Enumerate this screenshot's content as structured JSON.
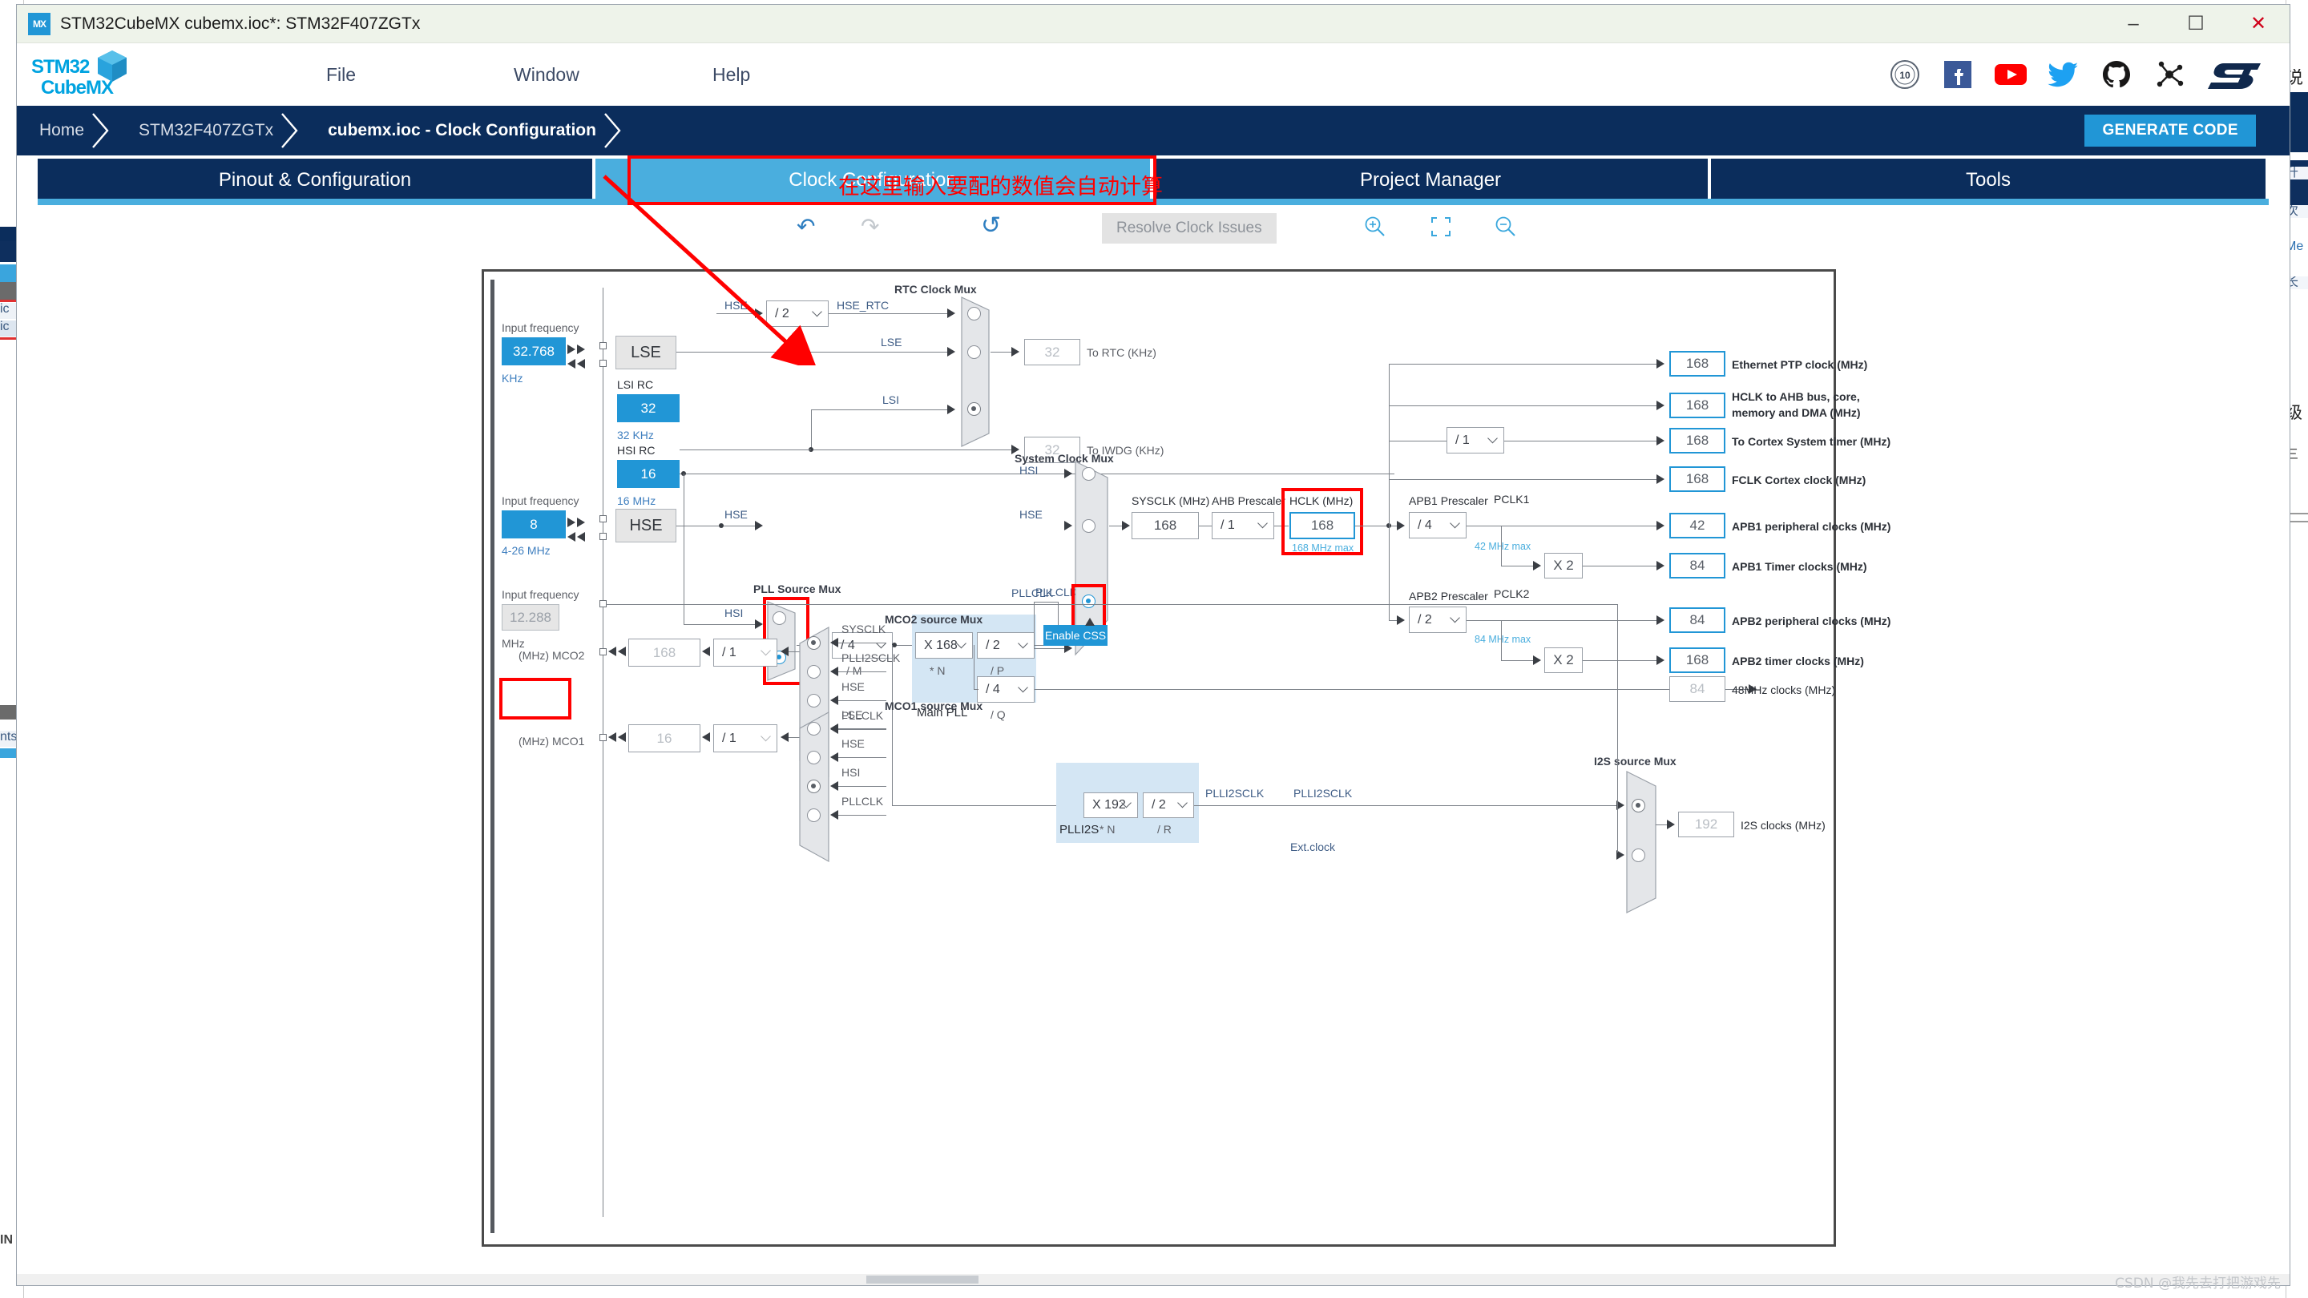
{
  "window": {
    "title": "STM32CubeMX cubemx.ioc*: STM32F407ZGTx",
    "app_icon": "mx-icon",
    "minimize": "─",
    "maximize": "☐",
    "close": "✕"
  },
  "brand": {
    "line1": "STM32",
    "line2": "CubeMX",
    "cube_icon": "cube-icon"
  },
  "menu": [
    {
      "label": "File"
    },
    {
      "label": "Window"
    },
    {
      "label": "Help"
    }
  ],
  "socials": [
    {
      "name": "anniversary-10-icon"
    },
    {
      "name": "facebook-icon"
    },
    {
      "name": "youtube-icon"
    },
    {
      "name": "twitter-icon"
    },
    {
      "name": "github-icon"
    },
    {
      "name": "community-icon"
    },
    {
      "name": "st-logo-icon"
    }
  ],
  "breadcrumb": {
    "items": [
      {
        "label": "Home",
        "active": false
      },
      {
        "label": "STM32F407ZGTx",
        "active": false
      },
      {
        "label": "cubemx.ioc - Clock Configuration",
        "active": true
      }
    ],
    "generate_code": "GENERATE CODE"
  },
  "tabs": [
    {
      "label": "Pinout & Configuration",
      "selected": false
    },
    {
      "label": "Clock Configuration",
      "selected": true
    },
    {
      "label": "Project Manager",
      "selected": false
    },
    {
      "label": "Tools",
      "selected": false
    }
  ],
  "toolbar": {
    "undo": "↶",
    "redo": "↷",
    "reset": "↺",
    "resolve_label": "Resolve Clock Issues",
    "zoom_in": "zoom-in-icon",
    "fit": "fit-to-screen-icon",
    "zoom_out": "zoom-out-icon"
  },
  "annotation": {
    "text": "在这里输入要配的数值会自动计算",
    "color": "#ff0000"
  },
  "watermark": "CSDN @我先去打把游戏先",
  "diagram": {
    "lse": {
      "input_frequency_label": "Input frequency",
      "value": "32.768",
      "unit": "KHz",
      "source_label": "LSE"
    },
    "lsi": {
      "title": "LSI RC",
      "value": "32",
      "unit": "32 KHz"
    },
    "hsi": {
      "title": "HSI RC",
      "value": "16",
      "unit": "16 MHz"
    },
    "hse": {
      "input_frequency_label": "Input frequency",
      "value": "8",
      "range": "4-26 MHz",
      "source_label": "HSE"
    },
    "i2s_in": {
      "input_frequency_label": "Input frequency",
      "value": "12.288",
      "unit": "MHz"
    },
    "rtc_mux": {
      "title": "RTC Clock Mux",
      "hse_label": "HSE",
      "hse_div": "/ 2",
      "hse_rtc_label": "HSE_RTC",
      "lse_label": "LSE",
      "lsi_label": "LSI",
      "selected": "LSI",
      "to_rtc_value": "32",
      "to_rtc_label": "To RTC (KHz)",
      "to_iwdg_value": "32",
      "to_iwdg_label": "To IWDG (KHz)"
    },
    "pll_source_mux": {
      "title": "PLL Source Mux",
      "hsi_label": "HSI",
      "hse_label": "HSE",
      "selected": "HSE"
    },
    "main_pll": {
      "title": "Main PLL",
      "m_value": "/ 4",
      "m_label": "/ M",
      "n_value": "X 168",
      "n_label": "* N",
      "p_value": "/ 2",
      "p_label": "/ P",
      "q_value": "/ 4",
      "q_label": "/ Q",
      "pllclk_label": "PLLCLK"
    },
    "plli2s": {
      "title": "PLLI2S",
      "n_value": "X 192",
      "n_label": "* N",
      "r_value": "/ 2",
      "r_label": "/ R",
      "out_label": "PLLI2SCLK"
    },
    "system_clock_mux": {
      "title": "System Clock Mux",
      "hsi_label": "HSI",
      "hse_label": "HSE",
      "pllclk_label": "PLLCLK",
      "selected": "PLLCLK",
      "enable_css": "Enable CSS"
    },
    "sysclk": {
      "label": "SYSCLK (MHz)",
      "value": "168"
    },
    "ahb_prescaler": {
      "label": "AHB Prescaler",
      "value": "/ 1"
    },
    "hclk": {
      "label": "HCLK (MHz)",
      "value": "168",
      "max_note": "168 MHz max"
    },
    "cortex_prescaler": {
      "value": "/ 1"
    },
    "apb1_prescaler": {
      "label": "APB1 Prescaler",
      "value": "/ 4",
      "bus_label": "PCLK1",
      "max_note": "42 MHz max",
      "mult": "X 2"
    },
    "apb2_prescaler": {
      "label": "APB2 Prescaler",
      "value": "/ 2",
      "bus_label": "PCLK2",
      "max_note": "84 MHz max",
      "mult": "X 2"
    },
    "outputs": [
      {
        "value": "168",
        "label": "Ethernet PTP clock (MHz)",
        "enabled": true
      },
      {
        "value": "168",
        "label": "HCLK to AHB bus, core,\nmemory and DMA (MHz)",
        "enabled": true
      },
      {
        "value": "168",
        "label": "To Cortex System timer (MHz)",
        "enabled": true
      },
      {
        "value": "168",
        "label": "FCLK Cortex clock (MHz)",
        "enabled": true
      },
      {
        "value": "42",
        "label": "APB1 peripheral clocks (MHz)",
        "enabled": true
      },
      {
        "value": "84",
        "label": "APB1 Timer clocks (MHz)",
        "enabled": true
      },
      {
        "value": "84",
        "label": "APB2 peripheral clocks (MHz)",
        "enabled": true
      },
      {
        "value": "168",
        "label": "APB2 timer clocks (MHz)",
        "enabled": true
      },
      {
        "value": "84",
        "label": "48MHz clocks (MHz)",
        "enabled": false
      }
    ],
    "output_ethernet": {
      "value": "168",
      "label": "Ethernet PTP clock (MHz)"
    },
    "output_hclk_ahb": {
      "value": "168",
      "label_line1": "HCLK to AHB bus, core,",
      "label_line2": "memory and DMA (MHz)"
    },
    "output_cortex_systimer": {
      "value": "168",
      "label": "To Cortex System timer (MHz)"
    },
    "output_fclk": {
      "value": "168",
      "label": "FCLK Cortex clock (MHz)"
    },
    "output_apb1_periph": {
      "value": "42",
      "label": "APB1 peripheral clocks (MHz)"
    },
    "output_apb1_timer": {
      "value": "84",
      "label": "APB1 Timer clocks (MHz)"
    },
    "output_apb2_periph": {
      "value": "84",
      "label": "APB2 peripheral clocks (MHz)"
    },
    "output_apb2_timer": {
      "value": "168",
      "label": "APB2 timer clocks (MHz)"
    },
    "output_48mhz": {
      "value": "84",
      "label": "48MHz clocks (MHz)"
    },
    "i2s_source_mux": {
      "title": "I2S source Mux",
      "plli2sclk_label": "PLLI2SCLK",
      "ext_clock_label": "Ext.clock",
      "selected": "PLLI2SCLK",
      "out_value": "192",
      "out_label": "I2S clocks (MHz)"
    },
    "mco2": {
      "title": "MCO2 source Mux",
      "pin_label": "(MHz) MCO2",
      "value": "168",
      "divider": "/ 1",
      "sources": [
        "SYSCLK",
        "PLLI2SCLK",
        "HSE",
        "PLLCLK"
      ],
      "selected": "SYSCLK"
    },
    "mco1": {
      "title": "MCO1 source Mux",
      "pin_label": "(MHz) MCO1",
      "value": "16",
      "divider": "/ 1",
      "sources": [
        "LSE",
        "HSE",
        "HSI",
        "PLLCLK"
      ],
      "selected": "HSI"
    }
  },
  "background_windows": {
    "right_texts": [
      "说",
      "升",
      "次",
      "Me",
      "长",
      "级",
      "三"
    ],
    "left_texts": [
      "ic",
      "ic",
      "nts",
      "IN"
    ]
  }
}
